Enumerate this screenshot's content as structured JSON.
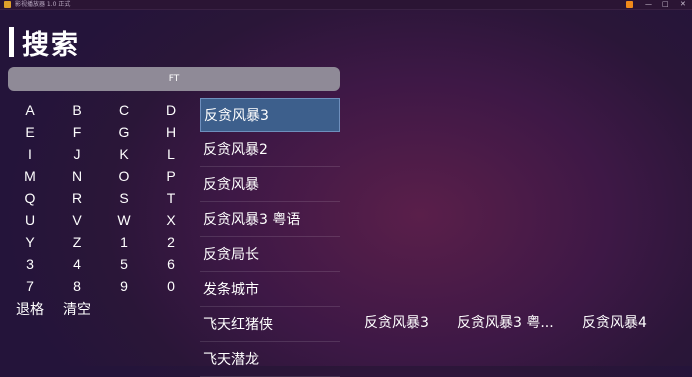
{
  "window": {
    "title": "影视播放器 1.0 正式",
    "minimize": "—",
    "maximize": "□",
    "close": "✕"
  },
  "page": {
    "title": "搜索"
  },
  "search": {
    "value": "FT"
  },
  "keyboard": {
    "rows": [
      [
        "A",
        "B",
        "C",
        "D"
      ],
      [
        "E",
        "F",
        "G",
        "H"
      ],
      [
        "I",
        "J",
        "K",
        "L"
      ],
      [
        "M",
        "N",
        "O",
        "P"
      ],
      [
        "Q",
        "R",
        "S",
        "T"
      ],
      [
        "U",
        "V",
        "W",
        "X"
      ],
      [
        "Y",
        "Z",
        "1",
        "2"
      ],
      [
        "3",
        "4",
        "5",
        "6"
      ],
      [
        "7",
        "8",
        "9",
        "0"
      ]
    ],
    "backspace": "退格",
    "clear": "清空"
  },
  "results": [
    "反贪风暴3",
    "反贪风暴2",
    "反贪风暴",
    "反贪风暴3 粤语",
    "反贪局长",
    "发条城市",
    "飞天红猪侠",
    "飞天潜龙"
  ],
  "selected_result_index": 0,
  "related": [
    "反贪风暴3",
    "反贪风暴3 粤...",
    "反贪风暴4"
  ],
  "colors": {
    "accent": "#3d5f8c",
    "search_box": "#8f8a97",
    "background": "#2a1638"
  }
}
